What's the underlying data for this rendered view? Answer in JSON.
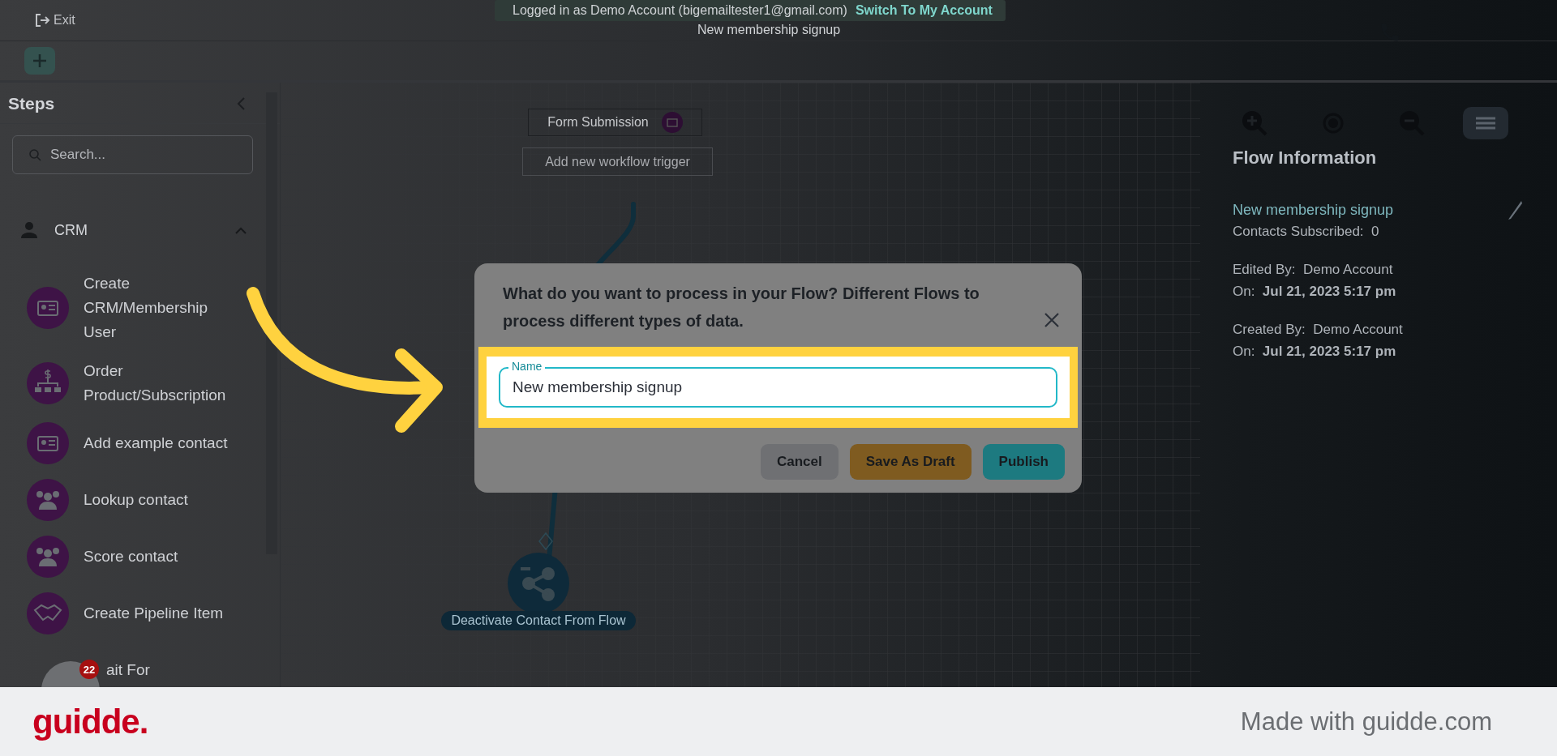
{
  "topbar": {
    "exit": "Exit",
    "banner": {
      "text": "Logged in as Demo Account (bigemailtester1@gmail.com)",
      "link": "Switch To My Account"
    },
    "title": "New membership signup"
  },
  "sidebar": {
    "title": "Steps",
    "search": {
      "placeholder": "Search..."
    },
    "group": {
      "label": "CRM",
      "expanded": true,
      "items": [
        {
          "label": "Create CRM/Membership User",
          "kind": "card"
        },
        {
          "label": "Order Product/Subscription",
          "kind": "order"
        },
        {
          "label": "Add example contact",
          "kind": "card"
        },
        {
          "label": "Lookup contact",
          "kind": "people"
        },
        {
          "label": "Score contact",
          "kind": "people"
        },
        {
          "label": "Create Pipeline Item",
          "kind": "handshake"
        },
        {
          "label": "ait For",
          "kind": "hidden"
        }
      ]
    }
  },
  "canvas": {
    "nodes": [
      {
        "kind": "trigger",
        "label": "Form Submission"
      },
      {
        "kind": "add",
        "label": "Add new workflow trigger"
      },
      {
        "kind": "action",
        "label": "Deactivate Contact From Flow"
      }
    ]
  },
  "flow_info": {
    "title": "Flow Information",
    "name": "New membership signup",
    "rows": [
      {
        "label": "Contacts Subscribed:",
        "value": "0",
        "kind": "plain"
      },
      {
        "label": "Edited By:",
        "value": "Demo Account",
        "kind": "plain"
      },
      {
        "label": "On:",
        "value": "Jul 21, 2023 5:17 pm",
        "kind": "date"
      },
      {
        "label": "Created By:",
        "value": "Demo Account",
        "kind": "plain"
      },
      {
        "label": "On:",
        "value": "Jul 21, 2023 5:17 pm",
        "kind": "date"
      }
    ]
  },
  "dialog": {
    "title": "What do you want to process in your Flow? Different Flows to process different types of data.",
    "field": {
      "label": "Name",
      "value": "New membership signup"
    },
    "buttons": [
      {
        "label": "Cancel",
        "kind": "cancel"
      },
      {
        "label": "Save As Draft",
        "kind": "draft"
      },
      {
        "label": "Publish",
        "kind": "publish"
      }
    ]
  },
  "chat": {
    "badge": "22"
  },
  "footer": {
    "logo": "guidde.",
    "text": "Made with guidde.com"
  }
}
